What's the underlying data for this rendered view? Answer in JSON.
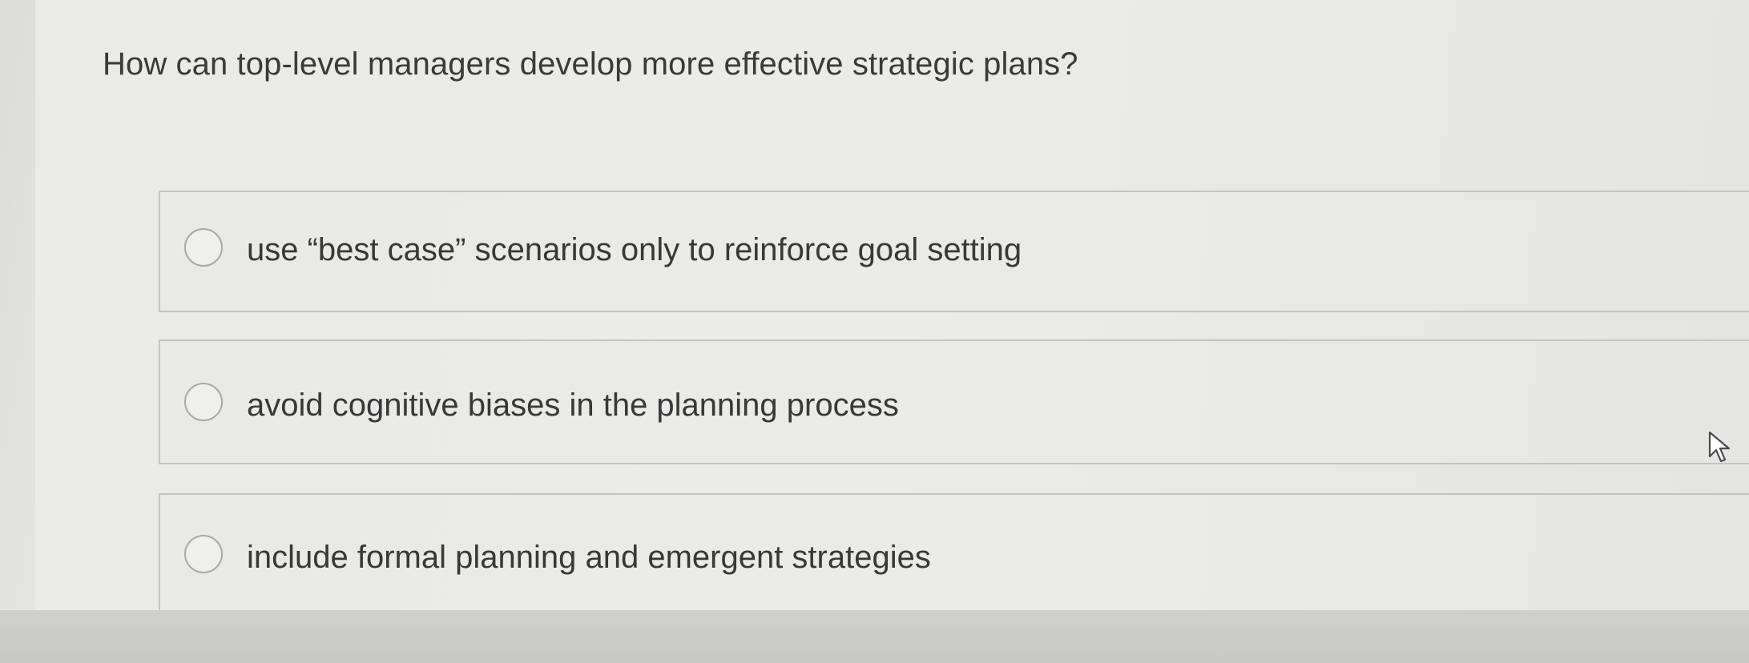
{
  "question": {
    "text": "How can top-level managers develop more effective strategic plans?"
  },
  "options": [
    {
      "label": "use “best case” scenarios only to reinforce goal setting",
      "selected": false
    },
    {
      "label": "avoid cognitive biases in the planning process",
      "selected": false
    },
    {
      "label": "include formal planning and emergent strategies",
      "selected": false
    }
  ],
  "cursor": {
    "icon": "pointer-arrow-icon"
  }
}
